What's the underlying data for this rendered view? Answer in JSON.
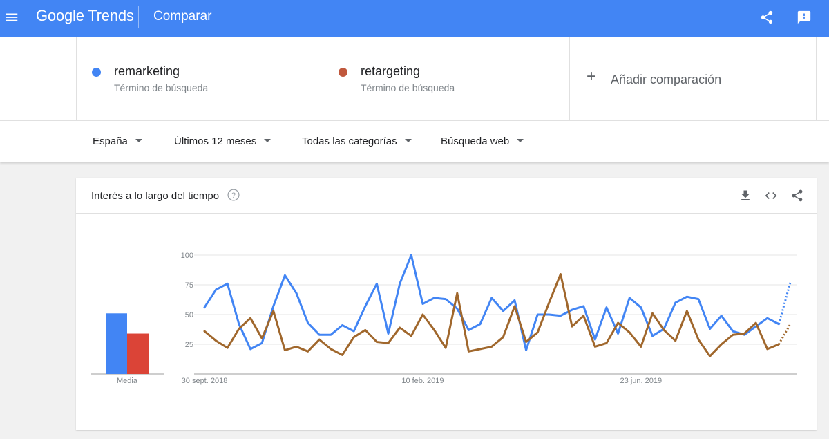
{
  "header": {
    "logo_text": "Google Trends",
    "page_title": "Comparar",
    "icons": [
      "menu-icon",
      "share-icon",
      "feedback-icon"
    ]
  },
  "terms": [
    {
      "name": "remarketing",
      "subtitle": "Término de búsqueda",
      "color": "#4285f4"
    },
    {
      "name": "retargeting",
      "subtitle": "Término de búsqueda",
      "color": "#c0583c"
    }
  ],
  "add_comparison": {
    "label": "Añadir comparación"
  },
  "filters": [
    {
      "label": "España"
    },
    {
      "label": "Últimos 12 meses"
    },
    {
      "label": "Todas las categorías"
    },
    {
      "label": "Búsqueda web"
    }
  ],
  "card": {
    "title": "Interés a lo largo del tiempo",
    "icons": [
      "help-icon",
      "download-icon",
      "embed-icon",
      "share-icon"
    ],
    "average_label": "Media"
  },
  "chart_data": {
    "type": "line",
    "ylim": [
      0,
      100
    ],
    "yticks": [
      25,
      50,
      75,
      100
    ],
    "x_tick_labels": [
      "30 sept. 2018",
      "10 feb. 2019",
      "23 jun. 2019"
    ],
    "x_tick_indices": [
      0,
      19,
      38
    ],
    "grid": true,
    "averages": [
      {
        "name": "remarketing",
        "value": 51,
        "color": "#4285f4"
      },
      {
        "name": "retargeting",
        "value": 34,
        "color": "#db4437"
      }
    ],
    "series": [
      {
        "name": "remarketing",
        "color": "#4285f4",
        "values": [
          56,
          71,
          76,
          42,
          21,
          26,
          57,
          83,
          68,
          43,
          33,
          33,
          41,
          36,
          57,
          76,
          34,
          76,
          100,
          59,
          64,
          63,
          55,
          37,
          42,
          64,
          53,
          62,
          20,
          50,
          50,
          49,
          54,
          57,
          29,
          56,
          34,
          64,
          56,
          32,
          38,
          60,
          65,
          63,
          38,
          49,
          36,
          33,
          40,
          47,
          42,
          77
        ],
        "partial_from_index": 50
      },
      {
        "name": "retargeting",
        "color": "#a0672c",
        "values": [
          36,
          28,
          22,
          38,
          47,
          30,
          53,
          20,
          23,
          19,
          29,
          21,
          16,
          31,
          37,
          27,
          26,
          39,
          32,
          50,
          37,
          22,
          68,
          19,
          21,
          23,
          31,
          57,
          27,
          35,
          60,
          84,
          40,
          49,
          23,
          26,
          43,
          35,
          23,
          51,
          37,
          28,
          53,
          29,
          15,
          25,
          33,
          34,
          43,
          21,
          25,
          42
        ],
        "partial_from_index": 50
      }
    ]
  }
}
